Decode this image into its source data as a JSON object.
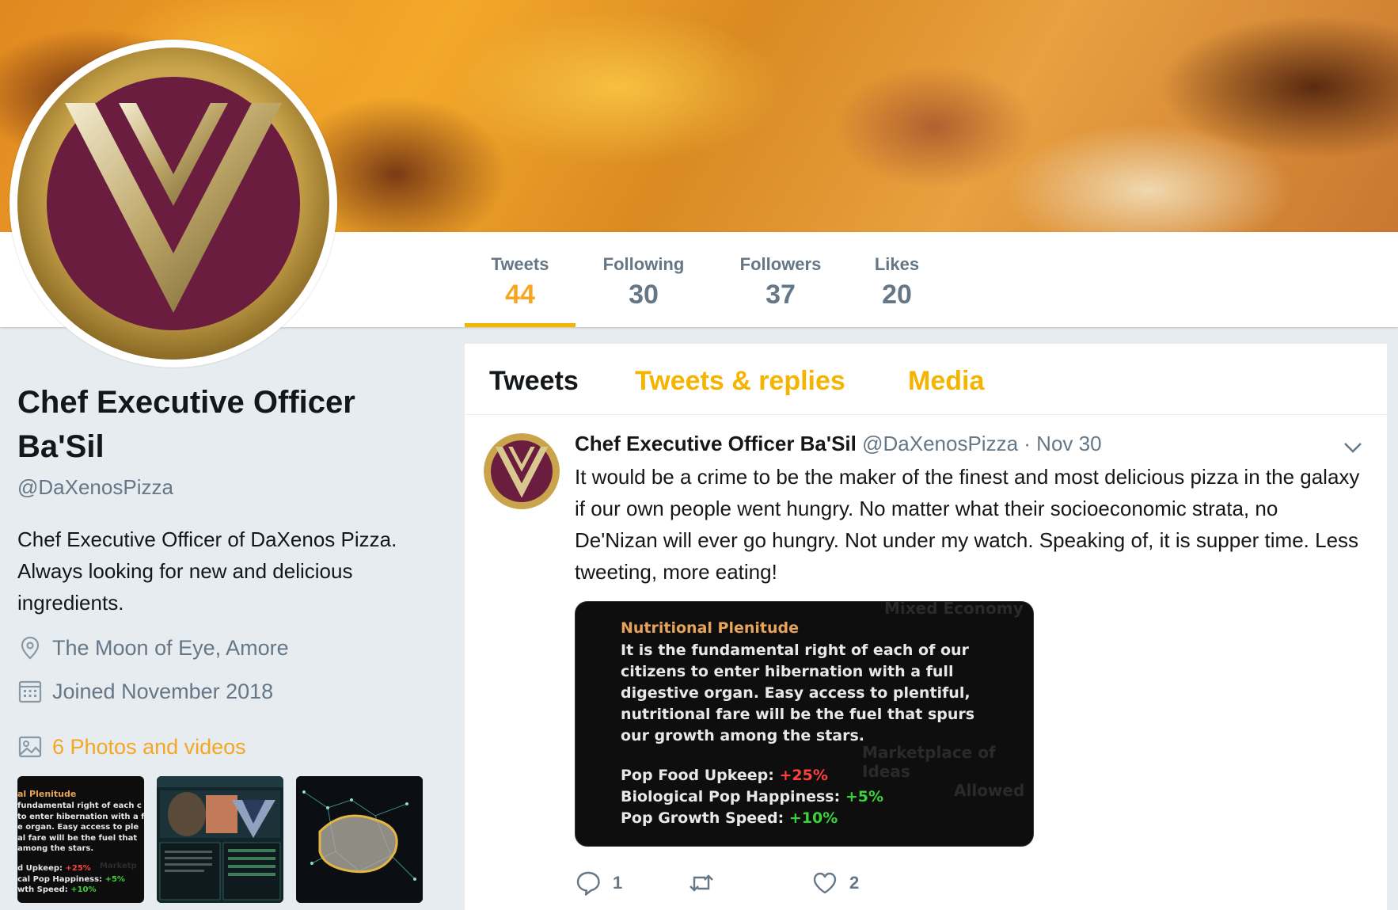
{
  "profile": {
    "name_line1": "Chef Executive Officer",
    "name_line2": "Ba'Sil",
    "handle": "@DaXenosPizza",
    "bio_line1": "Chef Executive Officer of DaXenos Pizza.",
    "bio_line2": "Always looking for new and delicious",
    "bio_line3": "ingredients.",
    "location": "The Moon of Eye, Amore",
    "joined": "Joined November 2018",
    "photos_label": "6 Photos and videos"
  },
  "stats": [
    {
      "label": "Tweets",
      "value": "44"
    },
    {
      "label": "Following",
      "value": "30"
    },
    {
      "label": "Followers",
      "value": "37"
    },
    {
      "label": "Likes",
      "value": "20"
    }
  ],
  "tabs": [
    "Tweets",
    "Tweets & replies",
    "Media"
  ],
  "tweet": {
    "name": "Chef Executive Officer Ba'Sil",
    "handle": "@DaXenosPizza",
    "date": "· Nov 30",
    "text": "It would be a crime to be the maker of the finest and most delicious pizza in the galaxy if our own people went hungry. No matter what their socioeconomic strata, no De'Nizan will ever go hungry. Not under my watch. Speaking of, it is supper time. Less tweeting, more eating!",
    "reply_count": "1",
    "retweet_count": "",
    "like_count": "2",
    "media": {
      "ghost_top": "Mixed Economy",
      "ghost_mid": "Marketplace of Ideas",
      "ghost_bot": "Allowed",
      "title": "Nutritional Plenitude",
      "body": "It is the fundamental right of each of our citizens to enter hibernation with a full digestive organ. Easy access to plentiful, nutritional fare will be the fuel that spurs our growth among the stars.",
      "stat1_label": "Pop Food Upkeep: ",
      "stat1_value": "+25%",
      "stat2_label": "Biological Pop Happiness: ",
      "stat2_value": "+5%",
      "stat3_label": "Pop Growth Speed: ",
      "stat3_value": "+10%"
    }
  },
  "thumb1": {
    "title": "al Plenitude",
    "lines": [
      " fundamental right of each c",
      " to enter hibernation with a f",
      "e organ. Easy access to ple",
      "al fare will be the fuel that",
      " among the stars."
    ],
    "stat1": "d Upkeep: ",
    "stat1_value": "+25%",
    "stat2": "cal Pop Happiness: ",
    "stat2_value": "+5%",
    "stat3": "wth Speed: ",
    "stat3_value": "+10%",
    "ghost": "Marketp"
  },
  "colors": {
    "accent": "#f5b400",
    "brand_gold": "#c9a44a",
    "brand_maroon": "#6b1d3f"
  }
}
